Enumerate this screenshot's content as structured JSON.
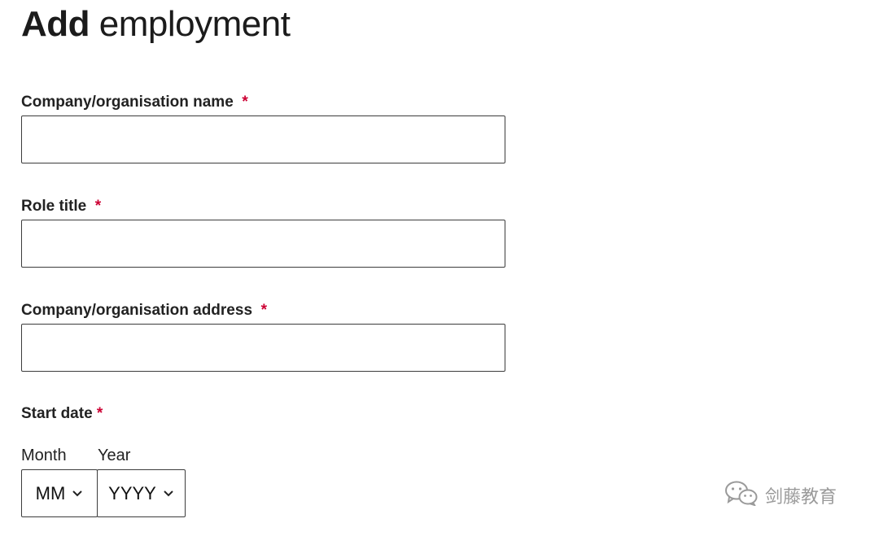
{
  "page": {
    "title_bold": "Add",
    "title_rest": "employment"
  },
  "form": {
    "required_mark": "*",
    "company_name": {
      "label": "Company/organisation name",
      "value": "",
      "placeholder": ""
    },
    "role_title": {
      "label": "Role title",
      "value": "",
      "placeholder": ""
    },
    "company_address": {
      "label": "Company/organisation address",
      "value": "",
      "placeholder": ""
    },
    "start_date": {
      "label": "Start date",
      "month_label": "Month",
      "year_label": "Year",
      "month_value": "MM",
      "year_value": "YYYY"
    }
  },
  "icons": {
    "select_chevron": "chevron-down-icon",
    "watermark": "wechat-icon"
  },
  "watermark": {
    "text": "剑藤教育"
  },
  "colors": {
    "text": "#222222",
    "required": "#cc0033",
    "input_border": "#3c3c3c",
    "watermark": "#9a9a9a"
  }
}
